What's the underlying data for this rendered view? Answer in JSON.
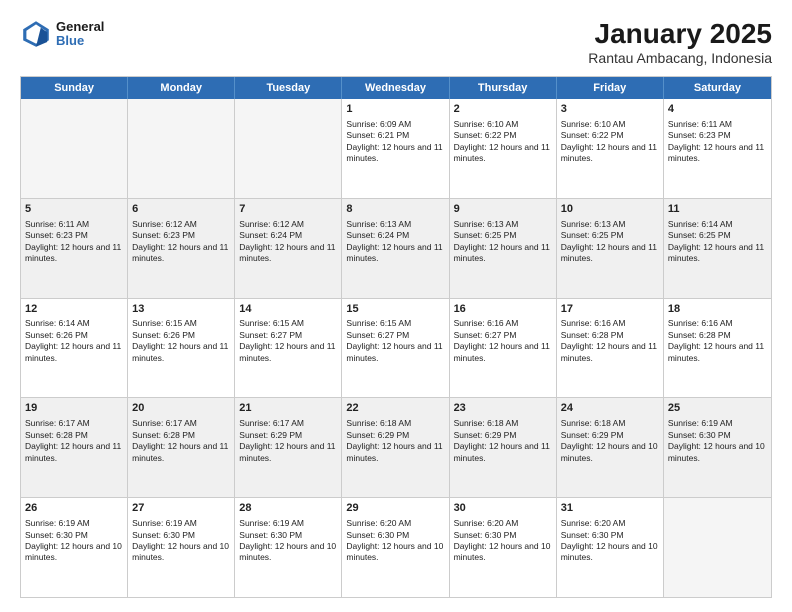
{
  "header": {
    "logo_line1": "General",
    "logo_line2": "Blue",
    "title": "January 2025",
    "subtitle": "Rantau Ambacang, Indonesia"
  },
  "days_of_week": [
    "Sunday",
    "Monday",
    "Tuesday",
    "Wednesday",
    "Thursday",
    "Friday",
    "Saturday"
  ],
  "weeks": [
    [
      {
        "day": "",
        "empty": true
      },
      {
        "day": "",
        "empty": true
      },
      {
        "day": "",
        "empty": true
      },
      {
        "day": "1",
        "sunrise": "6:09 AM",
        "sunset": "6:21 PM",
        "daylight": "12 hours and 11 minutes"
      },
      {
        "day": "2",
        "sunrise": "6:10 AM",
        "sunset": "6:22 PM",
        "daylight": "12 hours and 11 minutes"
      },
      {
        "day": "3",
        "sunrise": "6:10 AM",
        "sunset": "6:22 PM",
        "daylight": "12 hours and 11 minutes"
      },
      {
        "day": "4",
        "sunrise": "6:11 AM",
        "sunset": "6:23 PM",
        "daylight": "12 hours and 11 minutes"
      }
    ],
    [
      {
        "day": "5",
        "sunrise": "6:11 AM",
        "sunset": "6:23 PM",
        "daylight": "12 hours and 11 minutes"
      },
      {
        "day": "6",
        "sunrise": "6:12 AM",
        "sunset": "6:23 PM",
        "daylight": "12 hours and 11 minutes"
      },
      {
        "day": "7",
        "sunrise": "6:12 AM",
        "sunset": "6:24 PM",
        "daylight": "12 hours and 11 minutes"
      },
      {
        "day": "8",
        "sunrise": "6:13 AM",
        "sunset": "6:24 PM",
        "daylight": "12 hours and 11 minutes"
      },
      {
        "day": "9",
        "sunrise": "6:13 AM",
        "sunset": "6:25 PM",
        "daylight": "12 hours and 11 minutes"
      },
      {
        "day": "10",
        "sunrise": "6:13 AM",
        "sunset": "6:25 PM",
        "daylight": "12 hours and 11 minutes"
      },
      {
        "day": "11",
        "sunrise": "6:14 AM",
        "sunset": "6:25 PM",
        "daylight": "12 hours and 11 minutes"
      }
    ],
    [
      {
        "day": "12",
        "sunrise": "6:14 AM",
        "sunset": "6:26 PM",
        "daylight": "12 hours and 11 minutes"
      },
      {
        "day": "13",
        "sunrise": "6:15 AM",
        "sunset": "6:26 PM",
        "daylight": "12 hours and 11 minutes"
      },
      {
        "day": "14",
        "sunrise": "6:15 AM",
        "sunset": "6:27 PM",
        "daylight": "12 hours and 11 minutes"
      },
      {
        "day": "15",
        "sunrise": "6:15 AM",
        "sunset": "6:27 PM",
        "daylight": "12 hours and 11 minutes"
      },
      {
        "day": "16",
        "sunrise": "6:16 AM",
        "sunset": "6:27 PM",
        "daylight": "12 hours and 11 minutes"
      },
      {
        "day": "17",
        "sunrise": "6:16 AM",
        "sunset": "6:28 PM",
        "daylight": "12 hours and 11 minutes"
      },
      {
        "day": "18",
        "sunrise": "6:16 AM",
        "sunset": "6:28 PM",
        "daylight": "12 hours and 11 minutes"
      }
    ],
    [
      {
        "day": "19",
        "sunrise": "6:17 AM",
        "sunset": "6:28 PM",
        "daylight": "12 hours and 11 minutes"
      },
      {
        "day": "20",
        "sunrise": "6:17 AM",
        "sunset": "6:28 PM",
        "daylight": "12 hours and 11 minutes"
      },
      {
        "day": "21",
        "sunrise": "6:17 AM",
        "sunset": "6:29 PM",
        "daylight": "12 hours and 11 minutes"
      },
      {
        "day": "22",
        "sunrise": "6:18 AM",
        "sunset": "6:29 PM",
        "daylight": "12 hours and 11 minutes"
      },
      {
        "day": "23",
        "sunrise": "6:18 AM",
        "sunset": "6:29 PM",
        "daylight": "12 hours and 11 minutes"
      },
      {
        "day": "24",
        "sunrise": "6:18 AM",
        "sunset": "6:29 PM",
        "daylight": "12 hours and 10 minutes"
      },
      {
        "day": "25",
        "sunrise": "6:19 AM",
        "sunset": "6:30 PM",
        "daylight": "12 hours and 10 minutes"
      }
    ],
    [
      {
        "day": "26",
        "sunrise": "6:19 AM",
        "sunset": "6:30 PM",
        "daylight": "12 hours and 10 minutes"
      },
      {
        "day": "27",
        "sunrise": "6:19 AM",
        "sunset": "6:30 PM",
        "daylight": "12 hours and 10 minutes"
      },
      {
        "day": "28",
        "sunrise": "6:19 AM",
        "sunset": "6:30 PM",
        "daylight": "12 hours and 10 minutes"
      },
      {
        "day": "29",
        "sunrise": "6:20 AM",
        "sunset": "6:30 PM",
        "daylight": "12 hours and 10 minutes"
      },
      {
        "day": "30",
        "sunrise": "6:20 AM",
        "sunset": "6:30 PM",
        "daylight": "12 hours and 10 minutes"
      },
      {
        "day": "31",
        "sunrise": "6:20 AM",
        "sunset": "6:30 PM",
        "daylight": "12 hours and 10 minutes"
      },
      {
        "day": "",
        "empty": true
      }
    ]
  ]
}
